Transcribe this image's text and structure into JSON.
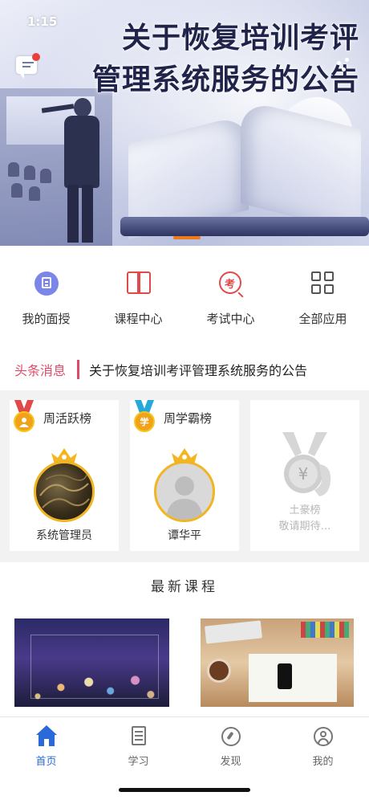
{
  "status_bar": {
    "time": "1:15"
  },
  "banner": {
    "headline_line1": "关于恢复培训考评",
    "headline_line2": "管理系统服务的公告"
  },
  "quick_nav": [
    {
      "label": "我的面授",
      "icon": "interview-doc-icon"
    },
    {
      "label": "课程中心",
      "icon": "open-book-icon"
    },
    {
      "label": "考试中心",
      "icon": "exam-icon"
    },
    {
      "label": "全部应用",
      "icon": "grid-apps-icon"
    }
  ],
  "news": {
    "tag": "头条消息",
    "text": "关于恢复培训考评管理系统服务的公告"
  },
  "ranks": {
    "weekly_active": {
      "title": "周活跃榜",
      "name": "系统管理员",
      "medal_char": ""
    },
    "weekly_study": {
      "title": "周学霸榜",
      "name": "谭华平",
      "medal_char": "学"
    },
    "rich": {
      "title": "土豪榜",
      "subtitle": "敬请期待…"
    }
  },
  "section_title": "最新课程",
  "tabbar": [
    {
      "label": "首页",
      "icon": "home-icon",
      "active": true
    },
    {
      "label": "学习",
      "icon": "study-icon"
    },
    {
      "label": "发现",
      "icon": "discover-icon"
    },
    {
      "label": "我的",
      "icon": "profile-icon"
    }
  ],
  "colors": {
    "accent_blue": "#2a6ad8",
    "news_pink": "#e04a6a",
    "icon_red": "#e04a4a",
    "gold": "#f1b422",
    "banner_indicator": "#f07a1b"
  }
}
